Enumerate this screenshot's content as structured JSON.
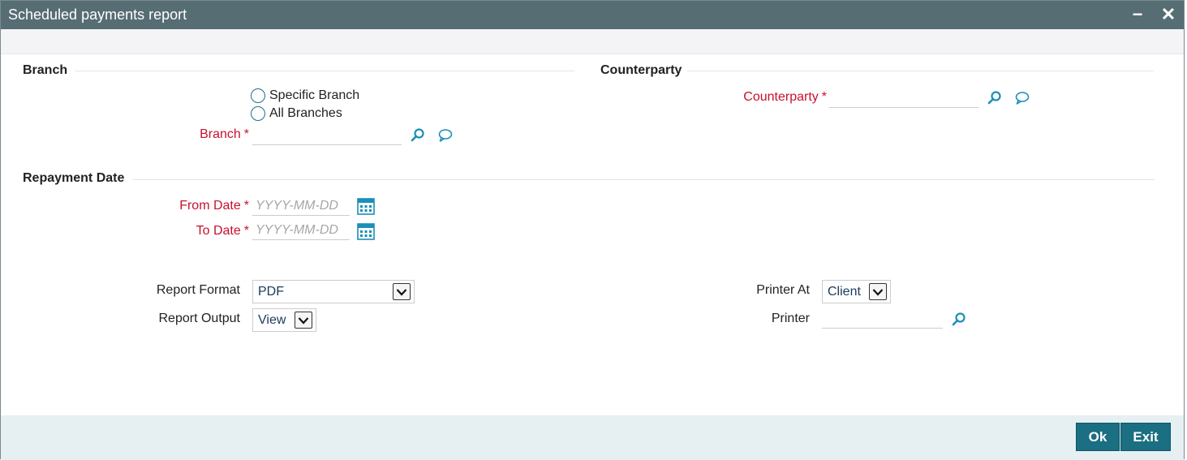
{
  "window": {
    "title": "Scheduled payments report",
    "minimize_glyph": "−",
    "close_glyph": "✕"
  },
  "branch_section": {
    "title": "Branch",
    "radio_specific": "Specific Branch",
    "radio_all": "All Branches",
    "branch_label": "Branch",
    "branch_value": ""
  },
  "counterparty_section": {
    "title": "Counterparty",
    "counterparty_label": "Counterparty",
    "counterparty_value": ""
  },
  "repayment_section": {
    "title": "Repayment Date",
    "from_label": "From Date",
    "from_placeholder": "YYYY-MM-DD",
    "to_label": "To Date",
    "to_placeholder": "YYYY-MM-DD"
  },
  "report": {
    "format_label": "Report Format",
    "format_value": "PDF",
    "output_label": "Report Output",
    "output_value": "View",
    "printer_at_label": "Printer At",
    "printer_at_value": "Client",
    "printer_label": "Printer",
    "printer_value": ""
  },
  "required_marker": "*",
  "footer": {
    "ok_label": "Ok",
    "exit_label": "Exit"
  },
  "colors": {
    "titlebar": "#566d73",
    "required": "#c8102e",
    "accent": "#1a6f82",
    "icon": "#1a8fb8"
  },
  "icons": [
    "search-icon",
    "comment-icon",
    "calendar-icon",
    "chevron-down-icon",
    "minimize-icon",
    "close-icon"
  ]
}
